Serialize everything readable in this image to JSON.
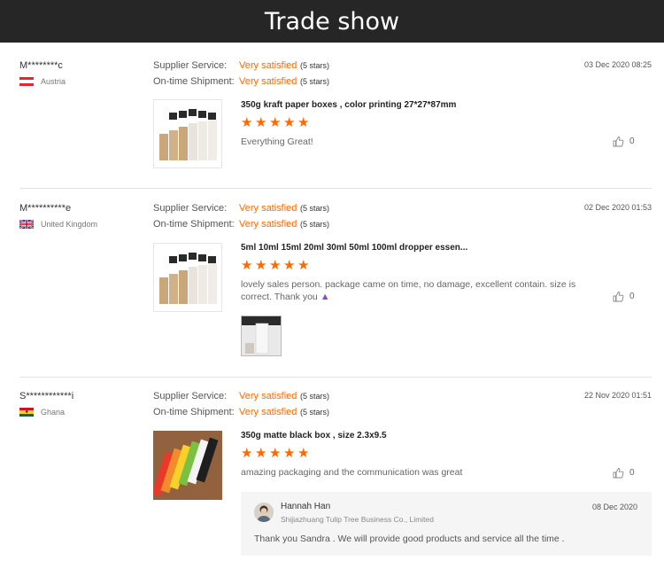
{
  "header": {
    "title": "Trade show"
  },
  "labels": {
    "supplier_service": "Supplier Service:",
    "ontime_shipment": "On-time Shipment:"
  },
  "colors": {
    "accent": "#ff6a00",
    "header_bg": "#262626"
  },
  "reviews": [
    {
      "user": "M********c",
      "country": "Austria",
      "date": "03 Dec 2020 08:25",
      "supplier_service": "Very satisfied",
      "supplier_stars": "(5 stars)",
      "shipment": "Very satisfied",
      "shipment_stars": "(5 stars)",
      "product": "350g kraft paper boxes , color printing 27*27*87mm",
      "rating": 5,
      "comment": "Everything Great!",
      "likes": "0"
    },
    {
      "user": "M**********e",
      "country": "United Kingdom",
      "date": "02 Dec 2020 01:53",
      "supplier_service": "Very satisfied",
      "supplier_stars": "(5 stars)",
      "shipment": "Very satisfied",
      "shipment_stars": "(5 stars)",
      "product": "5ml 10ml 15ml 20ml 30ml 50ml 100ml dropper essen...",
      "rating": 5,
      "comment": "lovely sales person. package came on time, no damage, excellent contain. size is correct. Thank you",
      "likes": "0"
    },
    {
      "user": "S************i",
      "country": "Ghana",
      "date": "22 Nov 2020 01:51",
      "supplier_service": "Very satisfied",
      "supplier_stars": "(5 stars)",
      "shipment": "Very satisfied",
      "shipment_stars": "(5 stars)",
      "product": "350g matte black box , size 2.3x9.5",
      "rating": 5,
      "comment": "amazing packaging and the communication was great",
      "likes": "0"
    }
  ],
  "reply": {
    "name": "Hannah Han",
    "company": "Shijiazhuang Tulip Tree Business Co., Limited",
    "date": "08 Dec 2020",
    "text": "Thank you Sandra . We will provide good products and service all the time ."
  }
}
